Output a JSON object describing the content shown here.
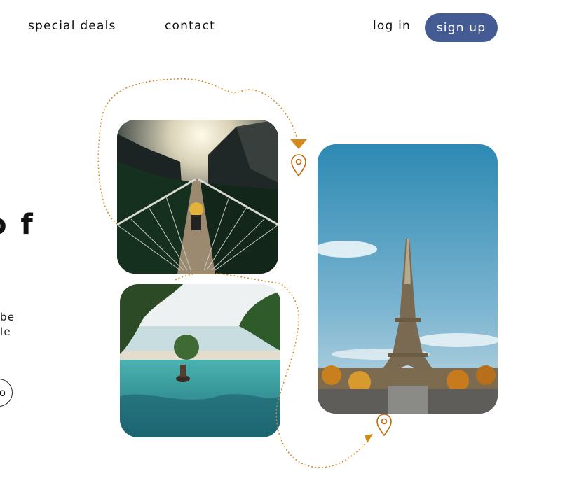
{
  "nav": {
    "special_deals": "special deals",
    "contact": "contact",
    "log_in": "log in",
    "sign_up": "sign up"
  },
  "hero": {
    "title_fragment": "o f",
    "text_line_1": "be",
    "text_line_2": "le",
    "cta_label": "o"
  },
  "colors": {
    "brand": "#445b94",
    "route": "#d4891b",
    "pin": "#c06a10"
  },
  "icons": [
    "location-pin-icon",
    "arrow-head-icon"
  ]
}
